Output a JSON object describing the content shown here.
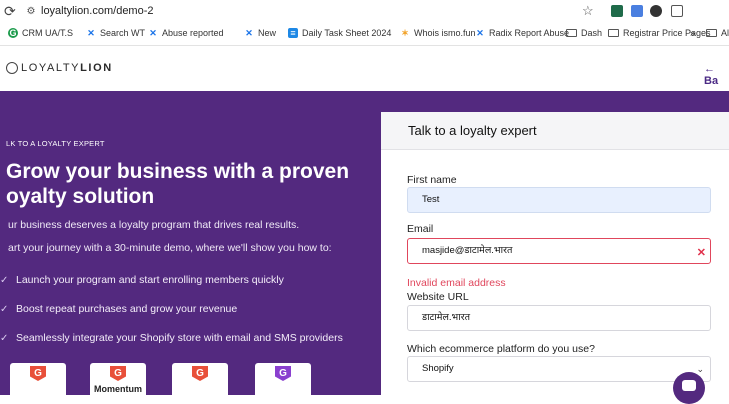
{
  "browser": {
    "url": "loyaltylion.com/demo-2",
    "bookmarks": [
      {
        "label": "CRM UA/T.S",
        "color": "#1a9a4a",
        "glyph": "G"
      },
      {
        "label": "Search WT",
        "color": "#1a73e8",
        "glyph": "X"
      },
      {
        "label": "Abuse reported",
        "color": "#1a73e8",
        "glyph": "X"
      },
      {
        "label": "New",
        "color": "#1a73e8",
        "glyph": "X"
      },
      {
        "label": "Daily Task Sheet 2024",
        "color": "#1e88e5",
        "glyph": "="
      },
      {
        "label": "Whois ismo.fun",
        "color": "#f2a32a",
        "glyph": "*"
      },
      {
        "label": "Radix Report Abuse",
        "color": "#1a73e8",
        "glyph": "X"
      },
      {
        "label": "Dash",
        "color": "",
        "glyph": "folder"
      },
      {
        "label": "Registrar Price Pages",
        "color": "",
        "glyph": "folder"
      },
      {
        "label": "All",
        "color": "",
        "glyph": "folder"
      }
    ],
    "more_label": "»"
  },
  "header": {
    "logo_light": "LOYALTY",
    "logo_bold": "LION",
    "back_label": "← Ba"
  },
  "hero": {
    "eyebrow": "LK TO A LOYALTY EXPERT",
    "headline_line1": "Grow your business with a proven",
    "headline_line2": "oyalty solution",
    "sub1": "ur business deserves a loyalty program that drives real results.",
    "sub2": "art your journey with a 30-minute demo, where we'll show you how to:",
    "benefits": [
      "Launch your program and start enrolling members quickly",
      "Boost repeat purchases and grow your revenue",
      "Seamlessly integrate your Shopify store with email and SMS providers"
    ],
    "badges": [
      {
        "text": ""
      },
      {
        "text": "Momentum"
      },
      {
        "text": ""
      },
      {
        "text": ""
      }
    ]
  },
  "form": {
    "title": "Talk to a loyalty expert",
    "first_name_label": "First name",
    "first_name_value": "Test",
    "email_label": "Email",
    "email_value": "masjide@डाटामेल.भारत",
    "email_error": "Invalid email address",
    "website_label": "Website URL",
    "website_value": "डाटामेल.भारत",
    "platform_label": "Which ecommerce platform do you use?",
    "platform_value": "Shopify"
  },
  "colors": {
    "hero_bg": "#53297f",
    "error": "#e0465c",
    "autofill_bg": "#e8f0fe"
  }
}
